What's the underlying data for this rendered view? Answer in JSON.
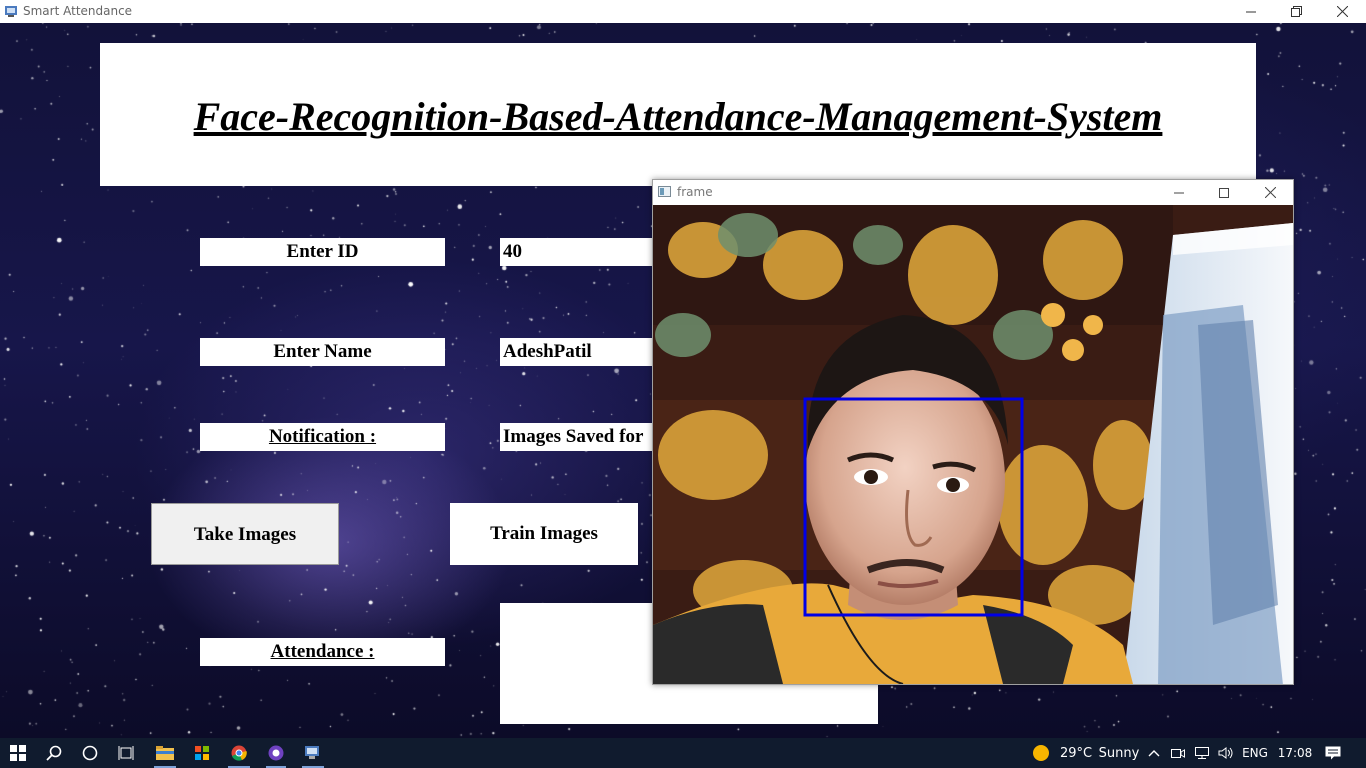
{
  "window": {
    "title": "Smart Attendance"
  },
  "header": {
    "title": "Face-Recognition-Based-Attendance-Management-System"
  },
  "form": {
    "id_label": "Enter ID",
    "id_value": "40",
    "name_label": "Enter Name",
    "name_value": "AdeshPatil",
    "notification_label": "Notification :",
    "notification_value": "Images Saved for",
    "attendance_label": "Attendance :",
    "attendance_value": ""
  },
  "buttons": {
    "take_images": "Take Images",
    "train_images": "Train Images"
  },
  "frame_window": {
    "title": "frame",
    "detection_box_color": "#0000e6"
  },
  "taskbar": {
    "weather_temp": "29°C",
    "weather_text": "Sunny",
    "language": "ENG",
    "time": "17:08"
  },
  "colors": {
    "background": "#12123a",
    "panel": "#ffffff",
    "taskbar": "#101b2e"
  }
}
